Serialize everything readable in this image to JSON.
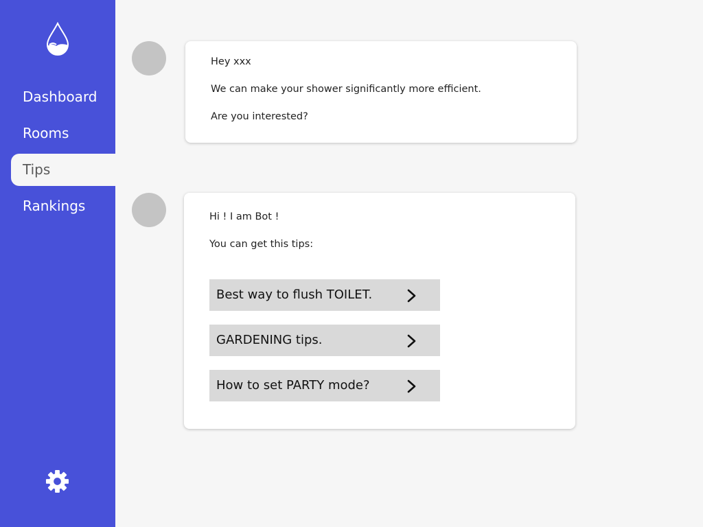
{
  "app": {
    "logo_icon": "water-drop-icon",
    "brand_color": "#4851d9",
    "background_color": "#f6f6f6"
  },
  "sidebar": {
    "items": [
      {
        "label": "Dashboard",
        "active": false
      },
      {
        "label": "Rooms",
        "active": false
      },
      {
        "label": "Tips",
        "active": true
      },
      {
        "label": "Rankings",
        "active": false
      }
    ],
    "settings_icon": "gear-icon"
  },
  "chat": {
    "messages": [
      {
        "lines": [
          "Hey xxx",
          "We can make your shower significantly more efficient.",
          "Are you interested?"
        ]
      },
      {
        "lines": [
          "Hi ! I am Bot !",
          "You can get this tips:"
        ],
        "tips": [
          {
            "label": "Best way to flush TOILET.",
            "icon": "chevron-right-icon"
          },
          {
            "label": "GARDENING tips.",
            "icon": "chevron-right-icon"
          },
          {
            "label": "How to set PARTY mode?",
            "icon": "chevron-right-icon"
          }
        ]
      }
    ]
  }
}
